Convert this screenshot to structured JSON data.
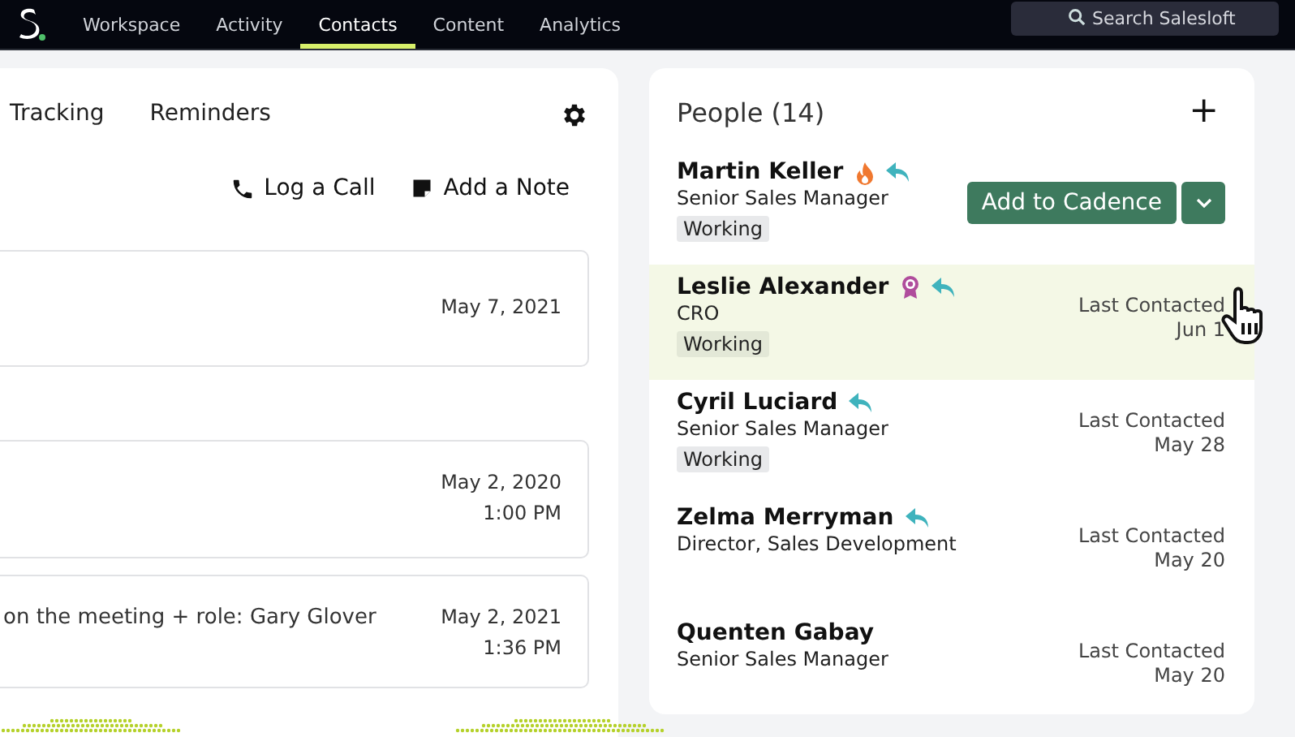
{
  "nav": {
    "items": [
      {
        "label": "Workspace",
        "selected": false
      },
      {
        "label": "Activity",
        "selected": false
      },
      {
        "label": "Contacts",
        "selected": true
      },
      {
        "label": "Content",
        "selected": false
      },
      {
        "label": "Analytics",
        "selected": false
      }
    ],
    "search": {
      "placeholder": "Search Salesloft"
    }
  },
  "record": {
    "tabs": [
      {
        "label": "Tracking",
        "selected": false
      },
      {
        "label": "Reminders",
        "selected": false
      }
    ],
    "actions": [
      {
        "kind": "call",
        "label": "Log a Call"
      },
      {
        "kind": "note",
        "label": "Add a Note"
      }
    ],
    "activities": [
      {
        "date": "May 7, 2021"
      },
      {
        "date": "May 2, 2020",
        "time": "1:00 PM"
      },
      {
        "text": "on the meeting + role: Gary Glover",
        "date": "May 2, 2021",
        "time": "1:36 PM"
      }
    ]
  },
  "people": {
    "title": "People (14)",
    "add": "+",
    "rows": [
      {
        "name": "Martin Keller",
        "hot": true,
        "award": false,
        "replied": true,
        "title": "Senior Sales Manager",
        "status": "Working",
        "selected": false,
        "kind": "actions",
        "primary": "Add to Cadence"
      },
      {
        "name": "Leslie Alexander",
        "hot": false,
        "award": true,
        "replied": true,
        "title": "CRO",
        "status": "Working",
        "selected": true,
        "kind": "contacted",
        "label": "Last Contacted",
        "date": "Jun 1"
      },
      {
        "name": "Cyril Luciard",
        "hot": false,
        "award": false,
        "replied": true,
        "title": "Senior Sales Manager",
        "status": "Working",
        "selected": false,
        "kind": "contacted",
        "label": "Last Contacted",
        "date": "May 28"
      },
      {
        "name": "Zelma Merryman",
        "hot": false,
        "award": false,
        "replied": true,
        "title": "Director, Sales Development",
        "selected": false,
        "kind": "contacted",
        "label": "Last Contacted",
        "date": "May 20"
      },
      {
        "name": "Quenten Gabay",
        "hot": false,
        "award": false,
        "replied": false,
        "title": "Senior Sales Manager",
        "selected": false,
        "kind": "contacted",
        "label": "Last Contacted",
        "date": "May 20"
      }
    ]
  }
}
